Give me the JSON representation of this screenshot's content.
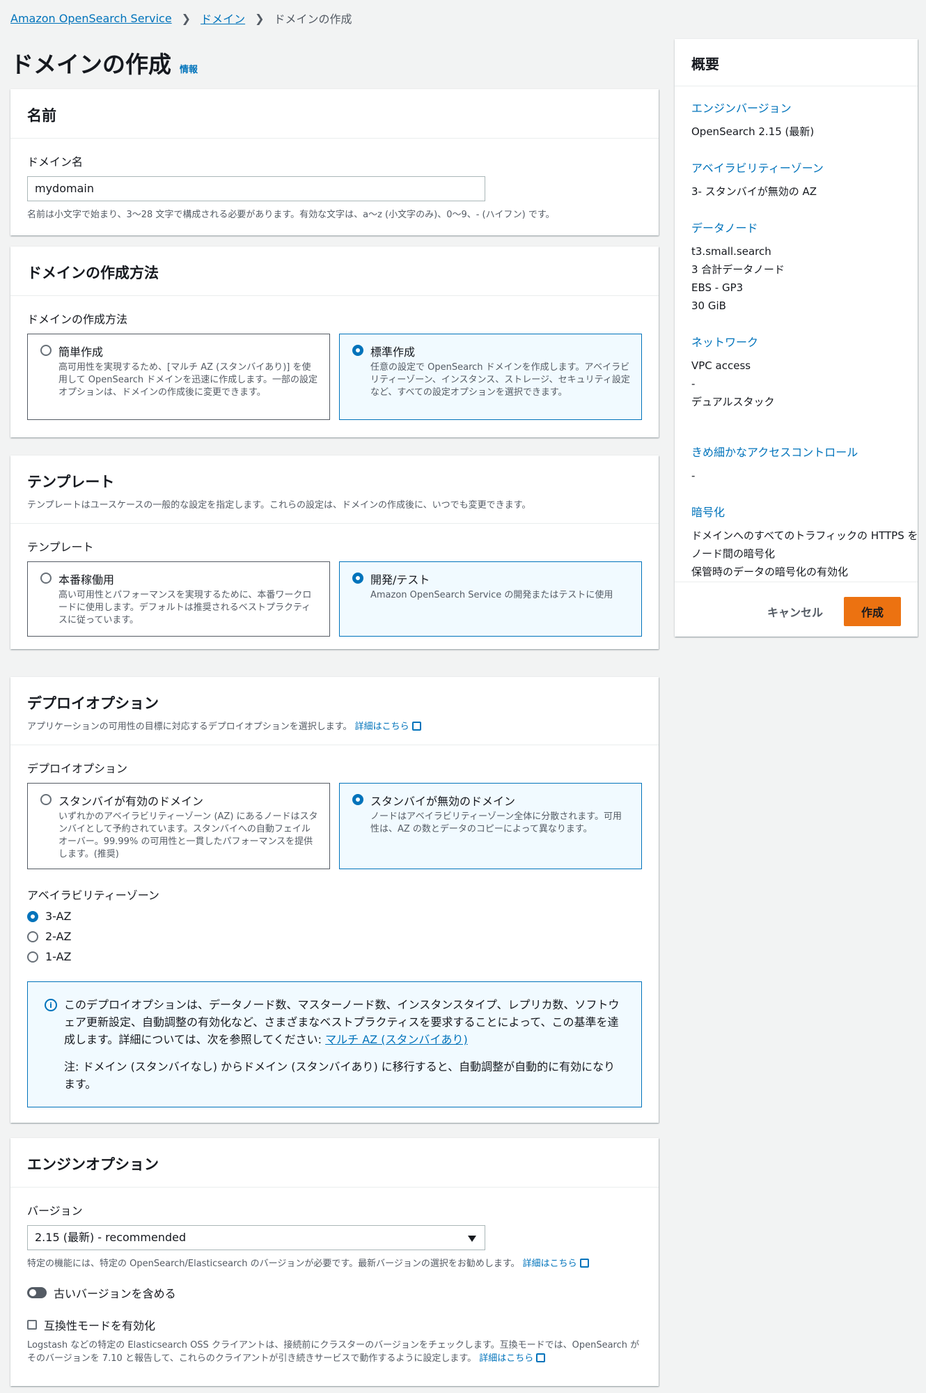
{
  "breadcrumb": {
    "service": "Amazon OpenSearch Service",
    "domains": "ドメイン",
    "current": "ドメインの作成"
  },
  "page": {
    "title": "ドメインの作成",
    "info": "情報"
  },
  "name_section": {
    "title": "名前",
    "label": "ドメイン名",
    "value": "mydomain",
    "constraint": "名前は小文字で始まり、3〜28 文字で構成される必要があります。有効な文字は、a〜z (小文字のみ)、0〜9、- (ハイフン) です。"
  },
  "method_section": {
    "title": "ドメインの作成方法",
    "label": "ドメインの作成方法",
    "options": [
      {
        "title": "簡単作成",
        "desc": "高可用性を実現するため、[マルチ AZ (スタンバイあり)] を使用して OpenSearch ドメインを迅速に作成します。一部の設定オプションは、ドメインの作成後に変更できます。",
        "selected": false
      },
      {
        "title": "標準作成",
        "desc": "任意の設定で OpenSearch ドメインを作成します。アベイラビリティーゾーン、インスタンス、ストレージ、セキュリティ設定など、すべての設定オプションを選択できます。",
        "selected": true
      }
    ]
  },
  "template_section": {
    "title": "テンプレート",
    "desc": "テンプレートはユースケースの一般的な設定を指定します。これらの設定は、ドメインの作成後に、いつでも変更できます。",
    "label": "テンプレート",
    "options": [
      {
        "title": "本番稼働用",
        "desc": "高い可用性とパフォーマンスを実現するために、本番ワークロードに使用します。デフォルトは推奨されるベストプラクティスに従っています。",
        "selected": false
      },
      {
        "title": "開発/テスト",
        "desc": "Amazon OpenSearch Service の開発またはテストに使用",
        "selected": true
      }
    ]
  },
  "deploy_section": {
    "title": "デプロイオプション",
    "desc": "アプリケーションの可用性の目標に対応するデプロイオプションを選択します。",
    "learn_more": "詳細はこちら",
    "label": "デプロイオプション",
    "options": [
      {
        "title": "スタンバイが有効のドメイン",
        "desc": "いずれかのアベイラビリティーゾーン (AZ) にあるノードはスタンバイとして予約されています。スタンバイへの自動フェイルオーバー。99.99% の可用性と一貫したパフォーマンスを提供します。(推奨)",
        "selected": false
      },
      {
        "title": "スタンバイが無効のドメイン",
        "desc": "ノードはアベイラビリティーゾーン全体に分散されます。可用性は、AZ の数とデータのコピーによって異なります。",
        "selected": true
      }
    ],
    "az_label": "アベイラビリティーゾーン",
    "az_options": [
      "3-AZ",
      "2-AZ",
      "1-AZ"
    ],
    "alert": {
      "text": "このデプロイオプションは、データノード数、マスターノード数、インスタンスタイプ、レプリカ数、ソフトウェア更新設定、自動調整の有効化など、さまざまなベストプラクティスを要求することによって、この基準を達成します。詳細については、次を参照してください: ",
      "link": "マルチ AZ (スタンバイあり)",
      "note": "注: ドメイン (スタンバイなし) からドメイン (スタンバイあり) に移行すると、自動調整が自動的に有効になります。"
    }
  },
  "engine_section": {
    "title": "エンジンオプション",
    "version_label": "バージョン",
    "version_value": "2.15 (最新) - recommended",
    "version_help": "特定の機能には、特定の OpenSearch/Elasticsearch のバージョンが必要です。最新バージョンの選択をお勧めします。",
    "learn_more": "詳細はこちら",
    "toggle_label": "古いバージョンを含める",
    "compat_label": "互換性モードを有効化",
    "compat_help": "Logstash などの特定の Elasticsearch OSS クライアントは、接続前にクラスターのバージョンをチェックします。互換モードでは、OpenSearch がそのバージョンを 7.10 と報告して、これらのクライアントが引き続きサービスで動作するように設定します。",
    "compat_link": "詳細はこちら"
  },
  "summary": {
    "title": "概要",
    "groups": [
      {
        "label": "エンジンバージョン",
        "values": [
          "OpenSearch 2.15 (最新)"
        ]
      },
      {
        "label": "アベイラビリティーゾーン",
        "values": [
          "3- スタンバイが無効の AZ"
        ]
      },
      {
        "label": "データノード",
        "values": [
          "t3.small.search",
          "3 合計データノード",
          "EBS - GP3",
          "30 GiB"
        ]
      },
      {
        "label": "ネットワーク",
        "values": [
          "VPC access",
          "-",
          "デュアルスタック"
        ]
      },
      {
        "label": "きめ細かなアクセスコントロール",
        "values": [
          "-"
        ]
      },
      {
        "label": "暗号化",
        "values": [
          "ドメインへのすべてのトラフィックの HTTPS を必須とする",
          "ノード間の暗号化",
          "保管時のデータの暗号化の有効化"
        ]
      }
    ],
    "cancel": "キャンセル",
    "create": "作成"
  },
  "colors": {
    "link": "#0073bb",
    "primary_button": "#ec7211",
    "selected_tile_bg": "#f1faff"
  }
}
